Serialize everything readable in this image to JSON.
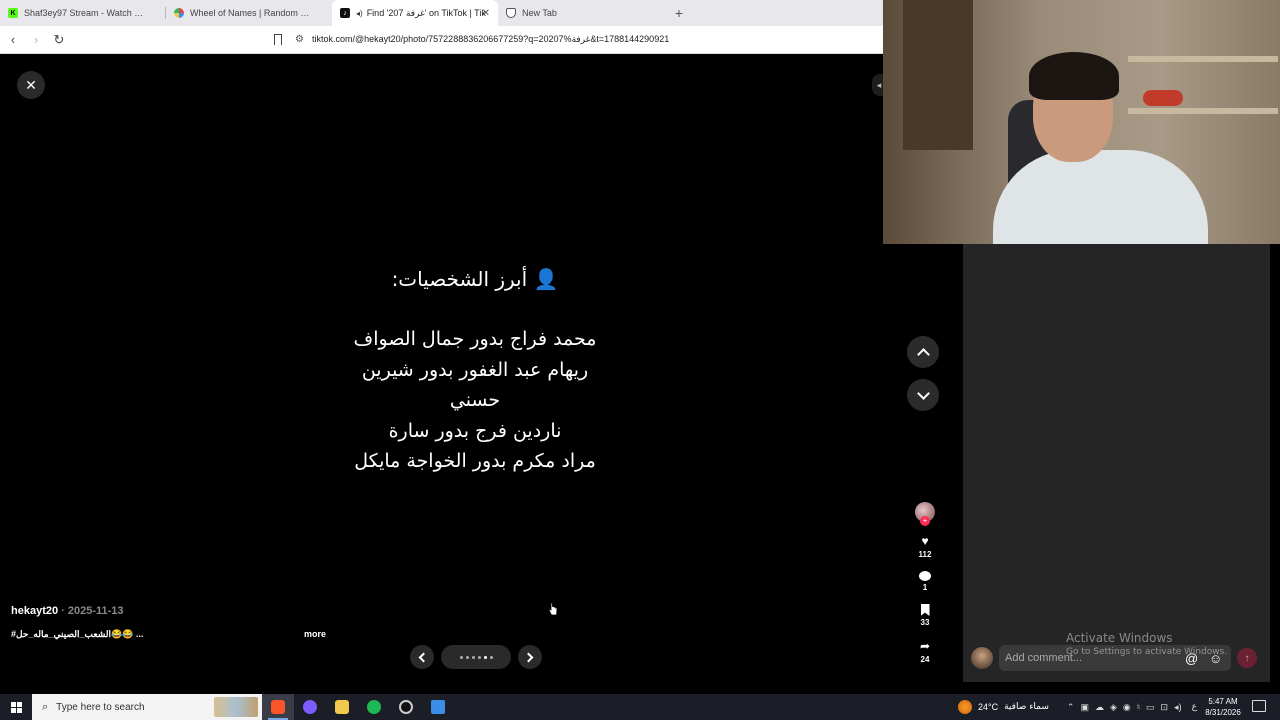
{
  "browser": {
    "tabs": [
      {
        "label": "Shaf3ey97 Stream - Watch Live on Ki",
        "icon": "kick-icon",
        "color": "#53fc18",
        "active": false
      },
      {
        "label": "Wheel of Names | Random name pic",
        "icon": "wheel-icon",
        "color": "#e04848",
        "active": false
      },
      {
        "label": "Find '207 غرفة' on TikTok | Tik",
        "icon": "tiktok-icon",
        "color": "#111111",
        "active": true
      },
      {
        "label": "New Tab",
        "icon": "brave-icon",
        "color": "#fb542b",
        "active": false
      }
    ],
    "new_tab_symbol": "+",
    "url": "tiktok.com/@hekayt20/photo/7572288836206677259?q=20207%غرفة&t=1788144290921"
  },
  "viewer": {
    "close_symbol": "✕",
    "slide": {
      "heading": "👤 أبرز الشخصيات:",
      "lines": [
        "محمد فراج بدور جمال الصواف",
        "ريهام عبد الغفور بدور شيرين",
        "حسني",
        "ناردين فرج بدور سارة",
        "مراد مكرم بدور الخواجة مايكل"
      ]
    },
    "actions": {
      "likes": "112",
      "comments": "1",
      "saves": "33",
      "shares": "24"
    },
    "author": "hekayt20",
    "date_sep": " · ",
    "date": "2025-11-13",
    "caption": "#الشعب_الصيني_ماله_حل😂😂 ...",
    "more": "more"
  },
  "comment": {
    "placeholder": "Add comment...",
    "at_symbol": "@",
    "emoji_symbol": "☺",
    "send_symbol": "↑"
  },
  "watermark": {
    "line1": "Activate Windows",
    "line2": "Go to Settings to activate Windows."
  },
  "taskbar": {
    "search_placeholder": "Type here to search",
    "apps": [
      {
        "name": "brave",
        "color": "#fb542b",
        "active": true
      },
      {
        "name": "chrome-profile",
        "color": "#7a5cff",
        "active": false
      },
      {
        "name": "file-explorer",
        "color": "#f2c94c",
        "active": false
      },
      {
        "name": "spotify",
        "color": "#1db954",
        "active": false
      },
      {
        "name": "capture",
        "color": "#cccccc",
        "active": false
      },
      {
        "name": "app-window",
        "color": "#3a8ee6",
        "active": false
      }
    ],
    "weather_temp": "24°C",
    "weather_text": "سماء صافية",
    "lang": "ع",
    "time": "5:47 AM",
    "date": "8/31/2026"
  }
}
